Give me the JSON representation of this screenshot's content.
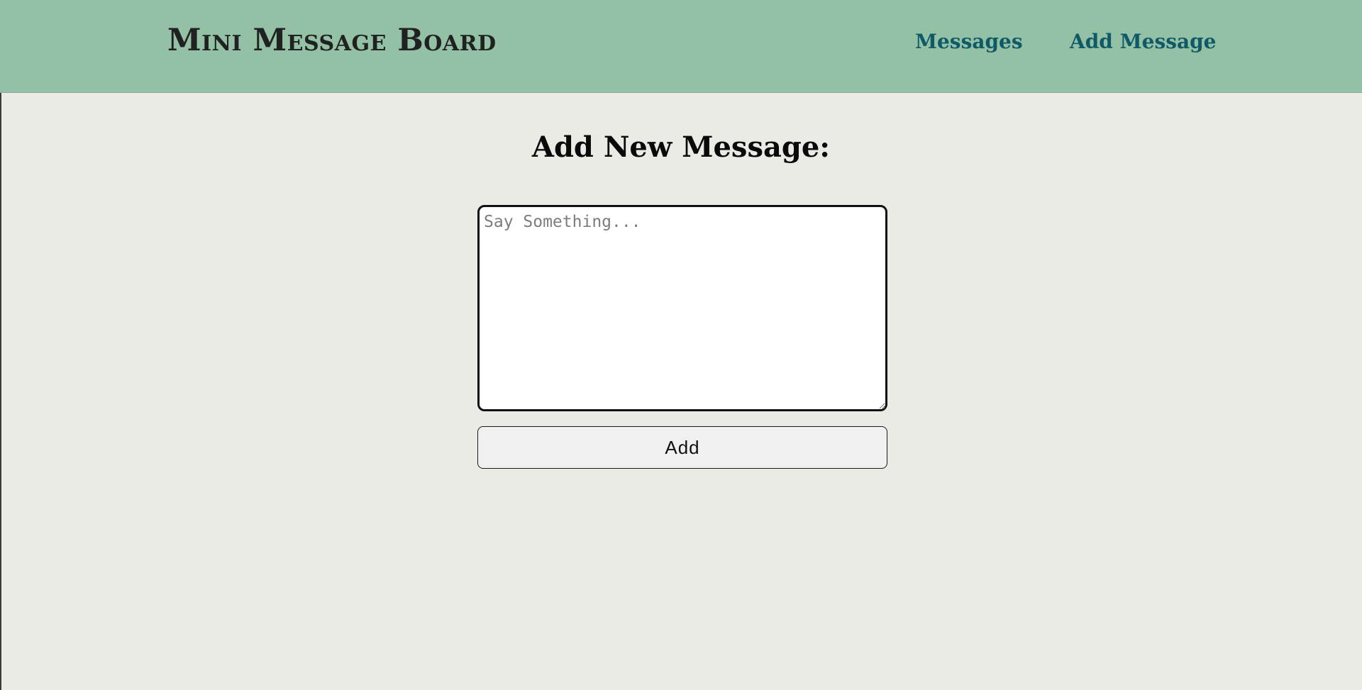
{
  "header": {
    "brand": "Mini Message Board",
    "nav": [
      {
        "label": "Messages"
      },
      {
        "label": "Add Message"
      }
    ]
  },
  "main": {
    "title": "Add New Message:",
    "textarea": {
      "value": "",
      "placeholder": "Say Something..."
    },
    "submit_label": "Add"
  },
  "colors": {
    "header_bg": "#94C0A5",
    "page_bg": "#EBEBE5",
    "nav_link": "#0F5A67",
    "brand_text": "#1F2220"
  }
}
